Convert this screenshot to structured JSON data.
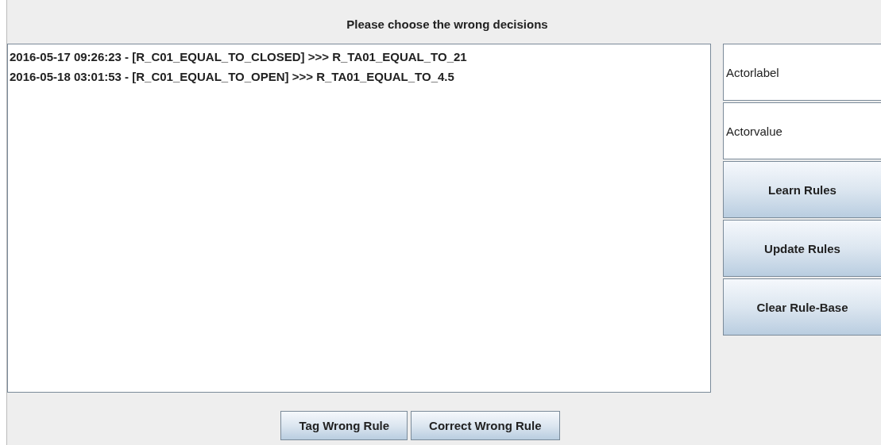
{
  "header": {
    "title": "Please choose the wrong decisions"
  },
  "decisions": [
    {
      "text": "2016-05-17 09:26:23 - [R_C01_EQUAL_TO_CLOSED] >>> R_TA01_EQUAL_TO_21"
    },
    {
      "text": "2016-05-18 03:01:53 - [R_C01_EQUAL_TO_OPEN] >>> R_TA01_EQUAL_TO_4.5"
    }
  ],
  "side_panel": {
    "labels": [
      "Actorlabel",
      "Actorvalue"
    ],
    "buttons": [
      "Learn Rules",
      "Update Rules",
      "Clear Rule-Base"
    ]
  },
  "bottom_buttons": [
    "Tag Wrong Rule",
    "Correct Wrong Rule"
  ]
}
